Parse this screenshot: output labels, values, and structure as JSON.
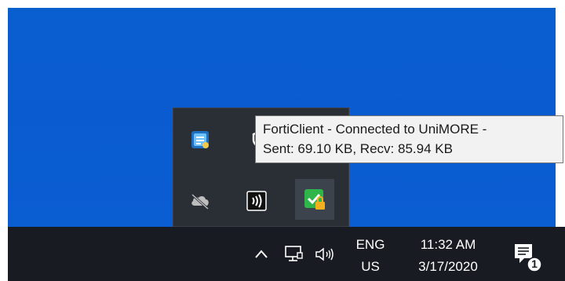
{
  "tooltip": {
    "line1": "FortiClient - Connected to UniMORE -",
    "line2": "Sent: 69.10 KB, Recv: 85.94 KB"
  },
  "tray_overflow": {
    "icons": [
      {
        "name": "app-icon",
        "color": "#2b88d8"
      },
      {
        "name": "shield-icon",
        "color": "#ffffff"
      },
      {
        "name": "cloud-offline-icon",
        "color": "#c8c8c8"
      },
      {
        "name": "audio-icon",
        "color": "#ffffff"
      },
      {
        "name": "forticlient-icon",
        "color": "#2ea043"
      }
    ]
  },
  "taskbar": {
    "chevron_icon": "chevron-up-icon",
    "network_icon": "network-icon",
    "volume_icon": "volume-icon",
    "language": {
      "line1": "ENG",
      "line2": "US"
    },
    "clock": {
      "time": "11:32 AM",
      "date": "3/17/2020"
    },
    "notifications": {
      "icon": "notification-icon",
      "count": "1"
    }
  }
}
